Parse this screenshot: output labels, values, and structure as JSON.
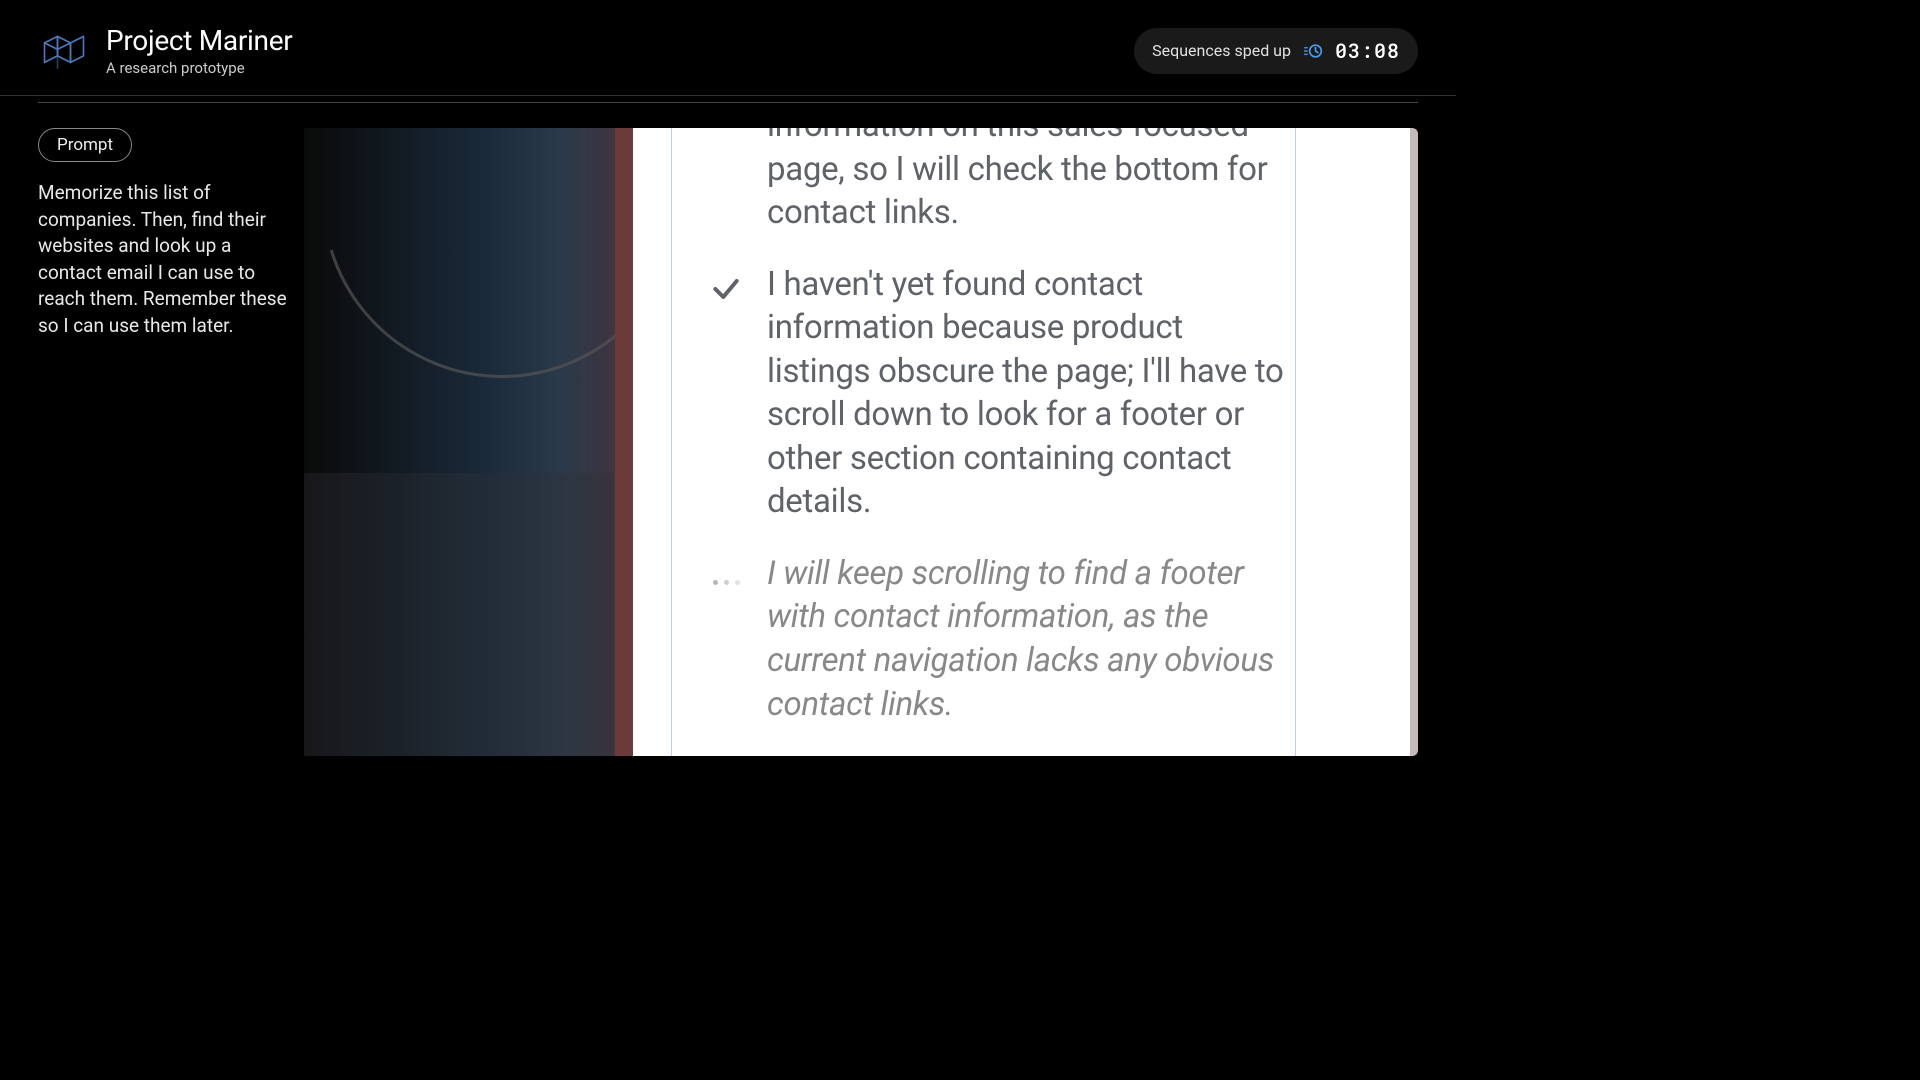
{
  "header": {
    "title": "Project Mariner",
    "subtitle": "A research prototype",
    "badge_label": "Sequences sped up",
    "time": "03:08"
  },
  "prompt": {
    "chip": "Prompt",
    "text": "Memorize this list of companies. Then, find their websites and look up a contact email I can use to reach them. Remember these so I can use them later."
  },
  "steps": {
    "partial_top": "information on this sales-focused page, so I will check the bottom for contact links.",
    "done": "I haven't yet found contact information because product listings obscure the page; I'll have to scroll down to look for a footer or other section containing contact details.",
    "thinking": "I will keep scrolling to find a footer with contact information, as the current navigation lacks any obvious contact links."
  }
}
